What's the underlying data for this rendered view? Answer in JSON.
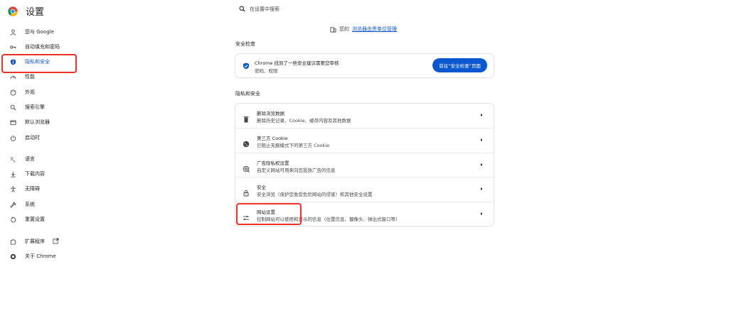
{
  "header": {
    "title": "设置",
    "search_placeholder": "在设置中搜索"
  },
  "sidebar": {
    "items": [
      {
        "label": "您与 Google",
        "icon": "person-icon"
      },
      {
        "label": "自动填充和密码",
        "icon": "key-icon"
      },
      {
        "label": "隐私和安全",
        "icon": "shield-icon",
        "active": true
      },
      {
        "label": "性能",
        "icon": "speedometer-icon"
      },
      {
        "label": "外观",
        "icon": "palette-icon"
      },
      {
        "label": "搜索引擎",
        "icon": "search-icon"
      },
      {
        "label": "默认浏览器",
        "icon": "browser-window-icon"
      },
      {
        "label": "启动时",
        "icon": "power-icon"
      },
      {
        "label": "语言",
        "icon": "translate-icon"
      },
      {
        "label": "下载内容",
        "icon": "download-icon"
      },
      {
        "label": "无障碍",
        "icon": "accessibility-icon"
      },
      {
        "label": "系统",
        "icon": "wrench-icon"
      },
      {
        "label": "重置设置",
        "icon": "reset-icon"
      },
      {
        "label": "扩展程序",
        "icon": "puzzle-icon"
      },
      {
        "label": "关于 Chrome",
        "icon": "chrome-icon"
      }
    ]
  },
  "main": {
    "managed_prefix": "您的",
    "managed_link": "浏览器由贵单位管理",
    "safety_check": {
      "section_title": "安全检查",
      "line1": "Chrome 找到了一些安全建议需要您审核",
      "line2": "密码、权限",
      "button": "前往“安全检查”页面"
    },
    "privacy": {
      "section_title": "隐私和安全",
      "rows": [
        {
          "title": "删除浏览数据",
          "subtitle": "删除历史记录、Cookie、缓存内容及其他数据",
          "icon": "trash-icon"
        },
        {
          "title": "第三方 Cookie",
          "subtitle": "已阻止无痕模式下的第三方 Cookie",
          "icon": "cookie-icon"
        },
        {
          "title": "广告隐私权设置",
          "subtitle": "自定义网站可用来向您投放广告的信息",
          "icon": "ad-privacy-icon"
        },
        {
          "title": "安全",
          "subtitle": "安全浏览（保护您免受危险网站的侵害）和其他安全设置",
          "icon": "lock-icon"
        },
        {
          "title": "网站设置",
          "subtitle": "控制网站可以使用和显示的信息（位置信息、摄像头、弹出式窗口等）",
          "icon": "sliders-icon"
        }
      ]
    }
  },
  "colors": {
    "accent": "#0b57d0",
    "highlight": "#ee3124"
  }
}
